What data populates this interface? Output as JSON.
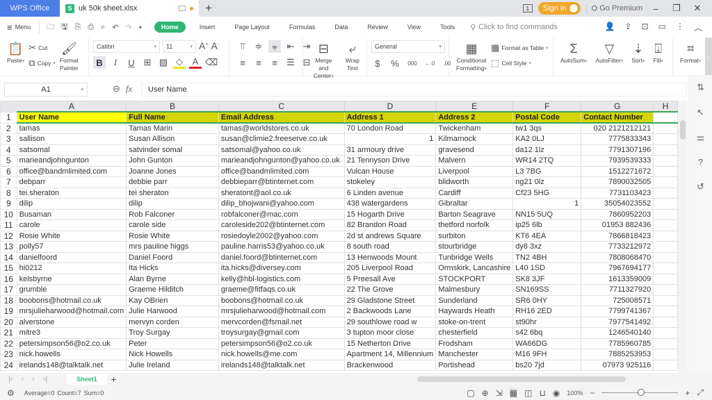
{
  "titlebar": {
    "app_name": "WPS Office",
    "document_tab": "uk 50k sheet.xlsx",
    "sheet_icon_letter": "S",
    "new_tab": "+",
    "window_count": "1",
    "signin_label": "Sign in",
    "premium_label": "Go Premium",
    "minimize": "–",
    "restore": "❐",
    "close": "✕"
  },
  "menubar": {
    "menu_label": "Menu",
    "tabs": [
      {
        "label": "Home",
        "active": true
      },
      {
        "label": "Insert"
      },
      {
        "label": "Page Layout"
      },
      {
        "label": "Formulas"
      },
      {
        "label": "Data"
      },
      {
        "label": "Review"
      },
      {
        "label": "View"
      },
      {
        "label": "Tools"
      }
    ],
    "search_placeholder": "Click to find commands"
  },
  "ribbon": {
    "paste": "Paste",
    "cut": "Cut",
    "copy": "Copy",
    "format_painter_1": "Format",
    "format_painter_2": "Painter",
    "font_name": "Calibri",
    "font_size": "11",
    "merge_center_1": "Merge and",
    "merge_center_2": "Center",
    "wrap_text_1": "Wrap",
    "wrap_text_2": "Text",
    "number_format": "General",
    "conditional_1": "Conditional",
    "conditional_2": "Formatting",
    "format_as_table": "Format as Table",
    "cell_style": "Cell Style",
    "autosum": "AutoSum",
    "autofilter": "AutoFilter",
    "sort": "Sort",
    "fill": "Fill",
    "format": "Format"
  },
  "formula_bar": {
    "cell_ref": "A1",
    "formula": "User Name"
  },
  "sheet": {
    "columns": [
      "A",
      "B",
      "C",
      "D",
      "E",
      "F",
      "G",
      "H"
    ],
    "header_row": [
      "User Name",
      "Full Name",
      "Email Address",
      "Address 1",
      "Address 2",
      "Postal Code",
      "Contact Number",
      ""
    ],
    "rows": [
      [
        "tamas",
        "Tamas  Marin",
        "tamas@worldstores.co.uk",
        "70 London Road",
        "Twickenham",
        "tw1 3qs",
        "020 2121212121",
        ""
      ],
      [
        "sallison",
        "Susan Allison",
        "susan@climie2.freeserve.co.uk",
        "1",
        "Kilmarnock",
        "KA2 0LJ",
        "7775833343",
        ""
      ],
      [
        "satsomal",
        "satvinder somal",
        "satsomal@yahoo.co.uk",
        "31 armoury drive",
        "gravesend",
        "da12 1lz",
        "7791307196",
        ""
      ],
      [
        "marieandjohngunton",
        "John Gunton",
        "marieandjohngunton@yahoo.co.uk",
        "21 Tennyson Drive",
        "Malvern",
        "WR14 2TQ",
        "7939539333",
        ""
      ],
      [
        "office@bandmlimited.com",
        "Joanne Jones",
        "office@bandmlimited.com",
        "Vulcan House",
        "Liverpool",
        "L3 7BG",
        "1512271672",
        ""
      ],
      [
        "debparr",
        "debbie parr",
        "debbieparr@btinternet.com",
        "stokeley",
        "blidworth",
        "ng21 0lz",
        "7890032505",
        ""
      ],
      [
        "tei.sheraton",
        "tei sheraton",
        "sheratont@aol.co.uk",
        "6 Linden avenue",
        "Cardiff",
        "Cf23 5HG",
        "7731103423",
        ""
      ],
      [
        "dilip",
        "dilip",
        "dilip_bhojwani@yahoo.com",
        "438 watergardens",
        "Gibraltar",
        "1",
        "35054023552",
        ""
      ],
      [
        "Busaman",
        "Rob Falconer",
        "robfalconer@mac.com",
        "15 Hogarth Drive",
        "Barton Seagrave",
        "NN15 5UQ",
        "7860952203",
        ""
      ],
      [
        "carole",
        "carole side",
        "caroleside202@btinternet.com",
        "82 Brandon Road",
        "thetford norfolk",
        "ip25 6lb",
        "01953 882436",
        ""
      ],
      [
        "Rosie White",
        "Rosie White",
        "rosiedoyle2002@yahoo.com",
        "2d st andrews Square",
        "surbiton",
        "KT6 4EA",
        "7866818423",
        ""
      ],
      [
        "polly57",
        "mrs pauline higgs",
        "pauline.harris53@yahoo.co.uk",
        "8 south road",
        "stourbridge",
        "dy8 3xz",
        "7733212972",
        ""
      ],
      [
        "danielfoord",
        "Daniel Foord",
        "daniel.foord@btinternet.com",
        "13 Henwoods Mount",
        "Tunbridge Wells",
        "TN2 4BH",
        "7808068470",
        ""
      ],
      [
        "hi0212",
        "Ita Hicks",
        "ita.hicks@diversey.com",
        "205 Liverpool Road",
        "Ormskirk, Lancashire",
        "L40 1SD",
        "7967694177",
        ""
      ],
      [
        "kelsbyrne",
        "Alan Byrne",
        "kelly@hbl-logistics.com",
        "5 Preesall Ave",
        "STOCKPORT",
        "SK8 3JF",
        "1613359009",
        ""
      ],
      [
        "grumble",
        "Graeme Hilditch",
        "graeme@fitfaqs.co.uk",
        "22 The Grove",
        "Malmesbury",
        "SN169SS",
        "7711327920",
        ""
      ],
      [
        "boobons@hotmail.co.uk",
        "Kay OBrien",
        "boobons@hotmail.co.uk",
        "29 Gladstone Street",
        "Sunderland",
        "SR6 0HY",
        "725008571",
        ""
      ],
      [
        "mrsjulieharwood@hotmail.com",
        "Julie Harwood",
        "mrsjulieharwood@hotmail.com",
        "2 Backwoods Lane",
        "Haywards Heath",
        "RH16 2ED",
        "7799741367",
        ""
      ],
      [
        "alverstone",
        "mervyn corden",
        "mervcorden@fsmail.net",
        "29 southlowe road w",
        "stoke-on-trent",
        "st90hr",
        "7977541492",
        ""
      ],
      [
        "mitre3",
        "Troy Surgay",
        "troysurgay@gmail.com",
        "3 tupton moor close",
        "chesterfield",
        "s42 6bq",
        "1246540140",
        ""
      ],
      [
        "petersimpson56@o2.co.uk",
        "Peter",
        "petersimpson56@o2.co.uk",
        "15 Netherton Drive",
        "Frodsham",
        "WA66DG",
        "7785960785",
        ""
      ],
      [
        "nick.howells",
        "Nick Howells",
        "nick.howells@me.com",
        "Apartment 14, Millennium",
        "Manchester",
        "M16 9FH",
        "7885253953",
        ""
      ],
      [
        "irelands148@talktalk.net",
        "Julie Ireland",
        "irelands148@talktalk.net",
        "Brackenwood",
        "Portishead",
        "bs20 7jd",
        "07973 925116",
        ""
      ]
    ]
  },
  "sheet_tabs": {
    "active": "Sheet1",
    "add": "+"
  },
  "statusbar": {
    "average": "Average=0",
    "count": "Count=7",
    "sum": "Sum=0",
    "zoom": "100%"
  },
  "colors": {
    "accent_green": "#2eb673",
    "header_fill": "#d5d500",
    "selected_fill": "#ffff00",
    "app_tab_blue": "#4d7de6",
    "signin_orange": "#f0a72a"
  }
}
